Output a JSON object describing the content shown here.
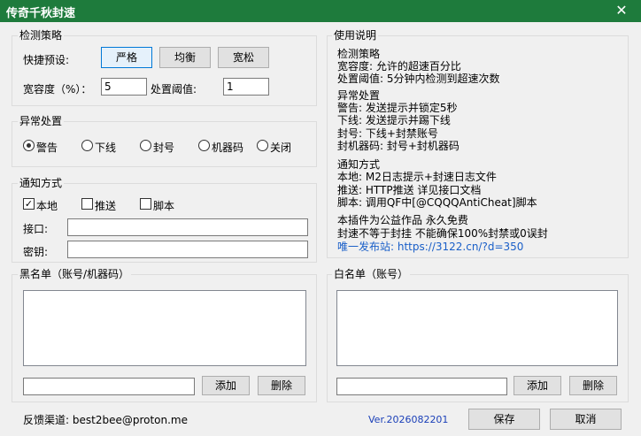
{
  "window": {
    "title": "传奇千秋封速"
  },
  "strategy": {
    "label": "检测策略",
    "preset_label": "快捷预设:",
    "presets": [
      "严格",
      "均衡",
      "宽松"
    ],
    "tolerance_label": "宽容度（%）：",
    "tolerance_value": "5",
    "threshold_label": "处置阈值:",
    "threshold_value": "1"
  },
  "abnormal": {
    "label": "异常处置",
    "options": [
      "警告",
      "下线",
      "封号",
      "机器码",
      "关闭"
    ],
    "selected": "警告"
  },
  "notify": {
    "label": "通知方式",
    "options": [
      "本地",
      "推送",
      "脚本"
    ],
    "checked": [
      "本地"
    ],
    "interface_label": "接口:",
    "interface_value": "",
    "key_label": "密钥:",
    "key_value": ""
  },
  "blacklist": {
    "label": "黑名单（账号/机器码）",
    "input_value": "",
    "add_label": "添加",
    "delete_label": "删除"
  },
  "whitelist": {
    "label": "白名单（账号）",
    "input_value": "",
    "add_label": "添加",
    "delete_label": "删除"
  },
  "help": {
    "label": "使用说明",
    "lines": [
      "检测策略",
      "宽容度: 允许的超速百分比",
      "处置阈值: 5分钟内检测到超速次数",
      "异常处置",
      "警告: 发送提示并锁定5秒",
      "下线: 发送提示并踢下线",
      "封号: 下线+封禁账号",
      "封机器码: 封号+封机器码",
      "通知方式",
      "本地: M2日志提示+封速日志文件",
      "推送: HTTP推送 详见接口文档",
      "脚本: 调用QF中[@CQQQAntiCheat]脚本",
      "本插件为公益作品 永久免费",
      "封速不等于封挂 不能确保100%封禁或0误封",
      "唯一发布站: https://3122.cn/?d=350"
    ]
  },
  "footer": {
    "feedback": "反馈渠道: best2bee@proton.me",
    "version": "Ver.2026082201",
    "save_label": "保存",
    "cancel_label": "取消"
  },
  "colors": {
    "titlebar": "#1e7b3c",
    "link": "#1a5fc8",
    "selected_border": "#0078d7"
  }
}
